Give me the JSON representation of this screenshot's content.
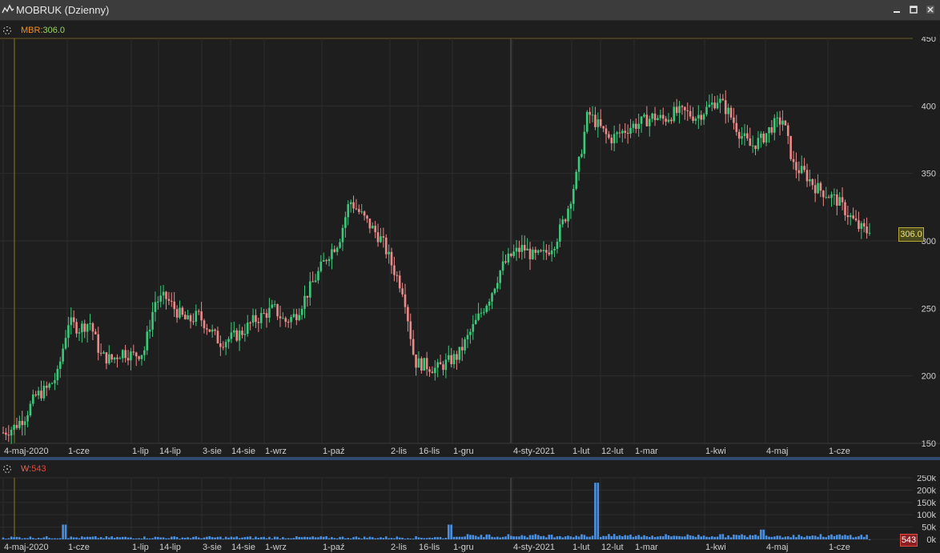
{
  "window": {
    "title": "MOBRUK (Dzienny)",
    "app_icon": "line-chart-icon",
    "controls": [
      "minimize-icon",
      "maximize-icon",
      "close-icon"
    ]
  },
  "price_pane": {
    "symbol_label": "MBR:",
    "last_value": "306.0",
    "price_tag": "306.0"
  },
  "volume_pane": {
    "label": "W:",
    "last_value": "543",
    "volume_tag": "543"
  },
  "colors": {
    "up_candle": "#3cc97a",
    "down_candle": "#ec8a8a",
    "volume_bar": "#4a90e2",
    "background": "#1e1e1e",
    "grid": "#2e2e2e",
    "separator": "#2f4a6e"
  },
  "chart_data": [
    {
      "type": "candlestick",
      "title": "MOBRUK (Dzienny)",
      "ylim": [
        150,
        450
      ],
      "y_ticks": [
        "450",
        "400",
        "350",
        "300",
        "250",
        "200",
        "150"
      ],
      "x_tick_labels": [
        "4-maj-2020",
        "1-cze",
        "1-lip",
        "14-lip",
        "3-sie",
        "14-sie",
        "1-wrz",
        "1-paź",
        "2-lis",
        "16-lis",
        "1-gru",
        "4-sty-2021",
        "1-lut",
        "12-lut",
        "1-mar",
        "1-kwi",
        "4-maj",
        "1-cze"
      ],
      "close_series_approx": [
        158,
        162,
        170,
        185,
        190,
        200,
        240,
        235,
        240,
        215,
        212,
        218,
        215,
        218,
        255,
        258,
        248,
        240,
        245,
        235,
        225,
        228,
        232,
        240,
        245,
        250,
        240,
        245,
        260,
        275,
        290,
        300,
        330,
        320,
        310,
        300,
        280,
        262,
        210,
        208,
        205,
        210,
        215,
        230,
        245,
        260,
        280,
        290,
        295,
        288,
        290,
        300,
        320,
        350,
        395,
        385,
        375,
        380,
        385,
        388,
        392,
        390,
        395,
        395,
        392,
        398,
        405,
        395,
        380,
        370,
        375,
        385,
        390,
        355,
        350,
        340,
        335,
        330,
        320,
        310,
        306
      ],
      "last_close": 306.0,
      "grid": true
    },
    {
      "type": "bar",
      "title": "W",
      "ylim": [
        0,
        250000
      ],
      "y_ticks": [
        "250k",
        "200k",
        "150k",
        "100k",
        "50k",
        "0k"
      ],
      "notable_values": [
        {
          "date": "1-gru",
          "value": 60000
        },
        {
          "date": "12-lut",
          "value": 230000
        },
        {
          "date": "4-maj",
          "value": 40000
        },
        {
          "date": "1-cze",
          "value": 60000
        }
      ],
      "baseline_value": 10000,
      "last_value": 543
    }
  ]
}
